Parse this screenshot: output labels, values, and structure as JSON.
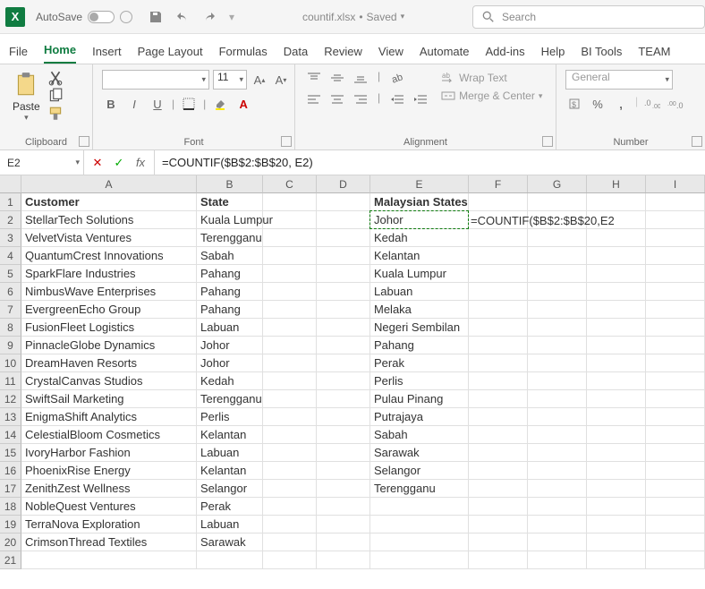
{
  "titlebar": {
    "autosave_label": "AutoSave",
    "autosave_state": "Off",
    "filename": "countif.xlsx",
    "save_status": "Saved",
    "search_placeholder": "Search"
  },
  "tabs": [
    "File",
    "Home",
    "Insert",
    "Page Layout",
    "Formulas",
    "Data",
    "Review",
    "View",
    "Automate",
    "Add-ins",
    "Help",
    "BI Tools",
    "TEAM"
  ],
  "active_tab": "Home",
  "ribbon": {
    "clipboard": {
      "label": "Clipboard",
      "paste": "Paste"
    },
    "font": {
      "label": "Font",
      "family": "",
      "size": "11"
    },
    "alignment": {
      "label": "Alignment",
      "wrap": "Wrap Text",
      "merge": "Merge & Center"
    },
    "number": {
      "label": "Number",
      "format": "General"
    }
  },
  "formula_bar": {
    "name_box": "E2",
    "formula": "=COUNTIF($B$2:$B$20, E2)"
  },
  "columns": [
    "A",
    "B",
    "C",
    "D",
    "E",
    "F",
    "G",
    "H",
    "I"
  ],
  "headers": {
    "A": "Customer",
    "B": "State",
    "E": "Malaysian States"
  },
  "rows": [
    {
      "n": 2,
      "A": "StellarTech Solutions",
      "B": "Kuala Lumpur",
      "E": "Johor",
      "F": "=COUNTIF($B$2:$B$20,E2"
    },
    {
      "n": 3,
      "A": "VelvetVista Ventures",
      "B": "Terengganu",
      "E": "Kedah"
    },
    {
      "n": 4,
      "A": "QuantumCrest Innovations",
      "B": "Sabah",
      "E": "Kelantan"
    },
    {
      "n": 5,
      "A": "SparkFlare Industries",
      "B": "Pahang",
      "E": "Kuala Lumpur"
    },
    {
      "n": 6,
      "A": "NimbusWave Enterprises",
      "B": "Pahang",
      "E": "Labuan"
    },
    {
      "n": 7,
      "A": "EvergreenEcho Group",
      "B": "Pahang",
      "E": "Melaka"
    },
    {
      "n": 8,
      "A": "FusionFleet Logistics",
      "B": "Labuan",
      "E": "Negeri Sembilan"
    },
    {
      "n": 9,
      "A": "PinnacleGlobe Dynamics",
      "B": "Johor",
      "E": "Pahang"
    },
    {
      "n": 10,
      "A": "DreamHaven Resorts",
      "B": "Johor",
      "E": "Perak"
    },
    {
      "n": 11,
      "A": "CrystalCanvas Studios",
      "B": "Kedah",
      "E": "Perlis"
    },
    {
      "n": 12,
      "A": "SwiftSail Marketing",
      "B": "Terengganu",
      "E": "Pulau Pinang"
    },
    {
      "n": 13,
      "A": "EnigmaShift Analytics",
      "B": "Perlis",
      "E": "Putrajaya"
    },
    {
      "n": 14,
      "A": "CelestialBloom Cosmetics",
      "B": "Kelantan",
      "E": "Sabah"
    },
    {
      "n": 15,
      "A": "IvoryHarbor Fashion",
      "B": "Labuan",
      "E": "Sarawak"
    },
    {
      "n": 16,
      "A": "PhoenixRise Energy",
      "B": "Kelantan",
      "E": "Selangor"
    },
    {
      "n": 17,
      "A": "ZenithZest Wellness",
      "B": "Selangor",
      "E": "Terengganu"
    },
    {
      "n": 18,
      "A": "NobleQuest Ventures",
      "B": "Perak"
    },
    {
      "n": 19,
      "A": "TerraNova Exploration",
      "B": "Labuan"
    },
    {
      "n": 20,
      "A": "CrimsonThread Textiles",
      "B": "Sarawak"
    },
    {
      "n": 21
    }
  ],
  "active_cell": "E2"
}
